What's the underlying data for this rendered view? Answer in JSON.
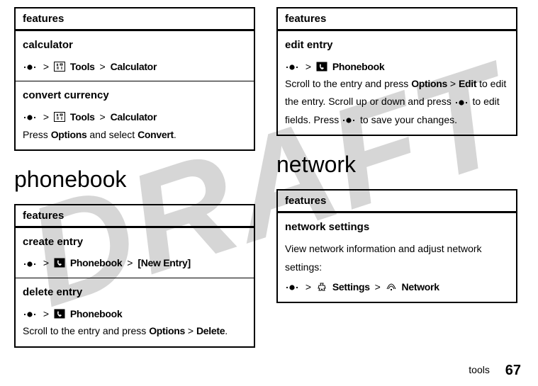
{
  "watermark": "DRAFT",
  "left": {
    "table1": {
      "header": "features",
      "rows": [
        {
          "title": "calculator",
          "seq": {
            "parts": [
              "Tools",
              "Calculator"
            ]
          }
        },
        {
          "title": "convert currency",
          "seq": {
            "parts": [
              "Tools",
              "Calculator"
            ]
          },
          "body_pre": "Press ",
          "body_b1": "Options",
          "body_mid": " and select ",
          "body_b2": "Convert",
          "body_post": "."
        }
      ]
    },
    "section": "phonebook",
    "table2": {
      "header": "features",
      "rows": [
        {
          "title": "create entry",
          "seq": {
            "parts": [
              "Phonebook",
              "[New Entry]"
            ]
          }
        },
        {
          "title": "delete entry",
          "seq": {
            "parts": [
              "Phonebook"
            ]
          },
          "body_pre": "Scroll to the entry and press ",
          "body_b1": "Options",
          "body_gt": " > ",
          "body_b2": "Delete",
          "body_post": "."
        }
      ]
    }
  },
  "right": {
    "table1": {
      "header": "features",
      "rows": [
        {
          "title": "edit entry",
          "seq": {
            "parts": [
              "Phonebook"
            ]
          },
          "body_line1_a": "Scroll to the entry and press ",
          "body_line1_b1": "Options",
          "body_line1_gt": " > ",
          "body_line1_b2": "Edit",
          "body_line1_c": " to edit the entry. Scroll up or down and press ",
          "body_line1_d": " to edit fields. Press ",
          "body_line1_e": " to save your changes."
        }
      ]
    },
    "section": "network",
    "table2": {
      "header": "features",
      "rows": [
        {
          "title": "network settings",
          "body": "View network information and adjust network settings:",
          "seq": {
            "parts": [
              "Settings",
              "Network"
            ]
          }
        }
      ]
    }
  },
  "footer": {
    "label": "tools",
    "page": "67"
  },
  "gt": ">"
}
